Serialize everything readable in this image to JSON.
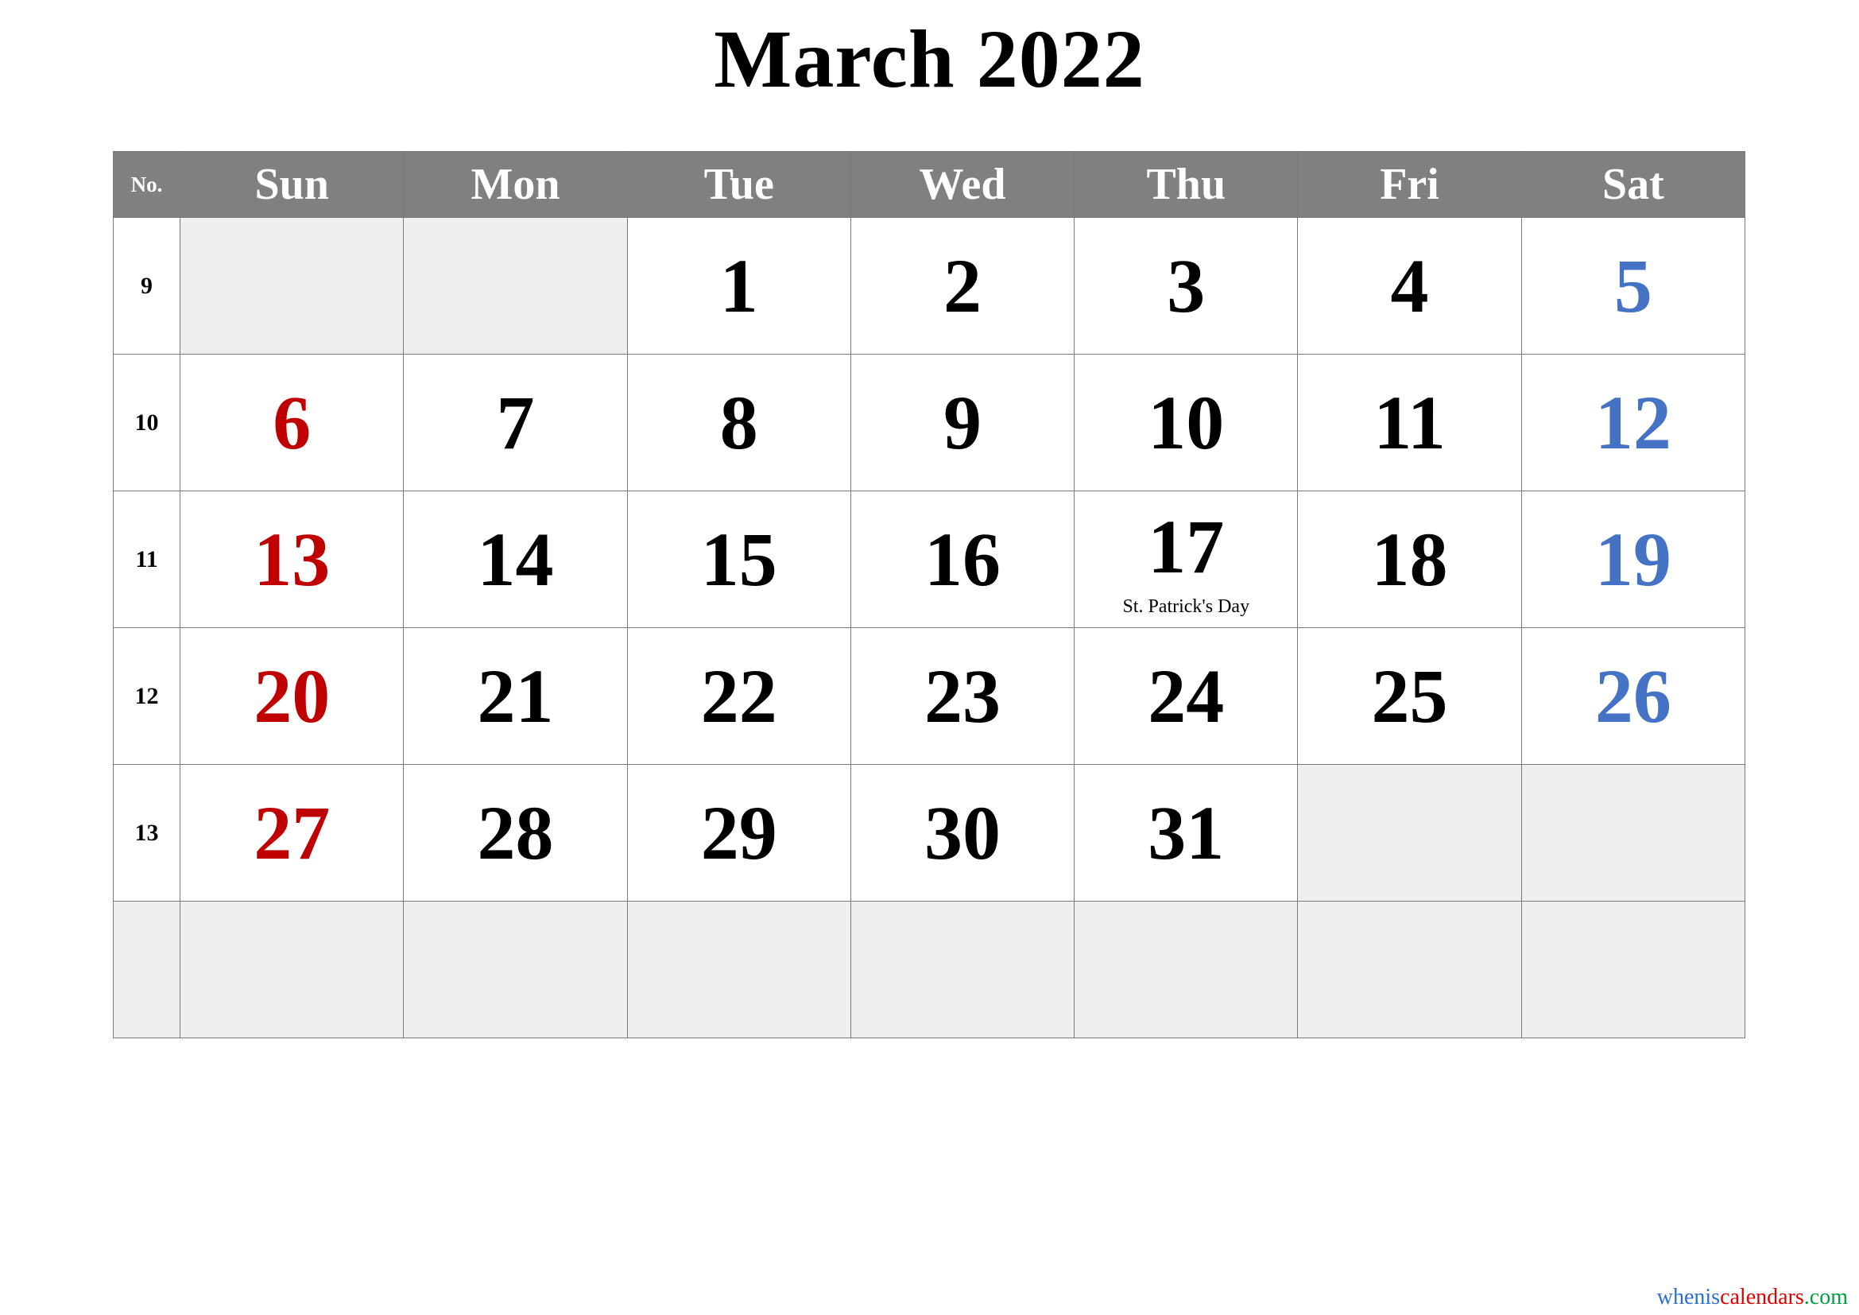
{
  "title": "March 2022",
  "header": {
    "week_number_label": "No.",
    "day_names": [
      "Sun",
      "Mon",
      "Tue",
      "Wed",
      "Thu",
      "Fri",
      "Sat"
    ]
  },
  "colors": {
    "header_background": "#808080",
    "header_text": "#ffffff",
    "sunday": "#C00000",
    "saturday": "#4472C4",
    "weekday": "#000000",
    "empty_cell": "#efefef",
    "grid_line": "#7a7a7a"
  },
  "weeks": [
    {
      "number": "9",
      "days": [
        {
          "label": "",
          "kind": "empty"
        },
        {
          "label": "",
          "kind": "empty"
        },
        {
          "label": "1",
          "kind": "weekday"
        },
        {
          "label": "2",
          "kind": "weekday"
        },
        {
          "label": "3",
          "kind": "weekday"
        },
        {
          "label": "4",
          "kind": "weekday"
        },
        {
          "label": "5",
          "kind": "saturday"
        }
      ]
    },
    {
      "number": "10",
      "days": [
        {
          "label": "6",
          "kind": "sunday"
        },
        {
          "label": "7",
          "kind": "weekday"
        },
        {
          "label": "8",
          "kind": "weekday"
        },
        {
          "label": "9",
          "kind": "weekday"
        },
        {
          "label": "10",
          "kind": "weekday"
        },
        {
          "label": "11",
          "kind": "weekday"
        },
        {
          "label": "12",
          "kind": "saturday"
        }
      ]
    },
    {
      "number": "11",
      "days": [
        {
          "label": "13",
          "kind": "sunday"
        },
        {
          "label": "14",
          "kind": "weekday"
        },
        {
          "label": "15",
          "kind": "weekday"
        },
        {
          "label": "16",
          "kind": "weekday"
        },
        {
          "label": "17",
          "kind": "weekday",
          "holiday": "St. Patrick's Day"
        },
        {
          "label": "18",
          "kind": "weekday"
        },
        {
          "label": "19",
          "kind": "saturday"
        }
      ]
    },
    {
      "number": "12",
      "days": [
        {
          "label": "20",
          "kind": "sunday"
        },
        {
          "label": "21",
          "kind": "weekday"
        },
        {
          "label": "22",
          "kind": "weekday"
        },
        {
          "label": "23",
          "kind": "weekday"
        },
        {
          "label": "24",
          "kind": "weekday"
        },
        {
          "label": "25",
          "kind": "weekday"
        },
        {
          "label": "26",
          "kind": "saturday"
        }
      ]
    },
    {
      "number": "13",
      "days": [
        {
          "label": "27",
          "kind": "sunday"
        },
        {
          "label": "28",
          "kind": "weekday"
        },
        {
          "label": "29",
          "kind": "weekday"
        },
        {
          "label": "30",
          "kind": "weekday"
        },
        {
          "label": "31",
          "kind": "weekday"
        },
        {
          "label": "",
          "kind": "empty"
        },
        {
          "label": "",
          "kind": "empty"
        }
      ]
    },
    {
      "number": "",
      "days": [
        {
          "label": "",
          "kind": "empty"
        },
        {
          "label": "",
          "kind": "empty"
        },
        {
          "label": "",
          "kind": "empty"
        },
        {
          "label": "",
          "kind": "empty"
        },
        {
          "label": "",
          "kind": "empty"
        },
        {
          "label": "",
          "kind": "empty"
        },
        {
          "label": "",
          "kind": "empty"
        }
      ]
    }
  ],
  "watermark": {
    "part1": "whenis",
    "part2": "calendars",
    "part3": ".com"
  }
}
